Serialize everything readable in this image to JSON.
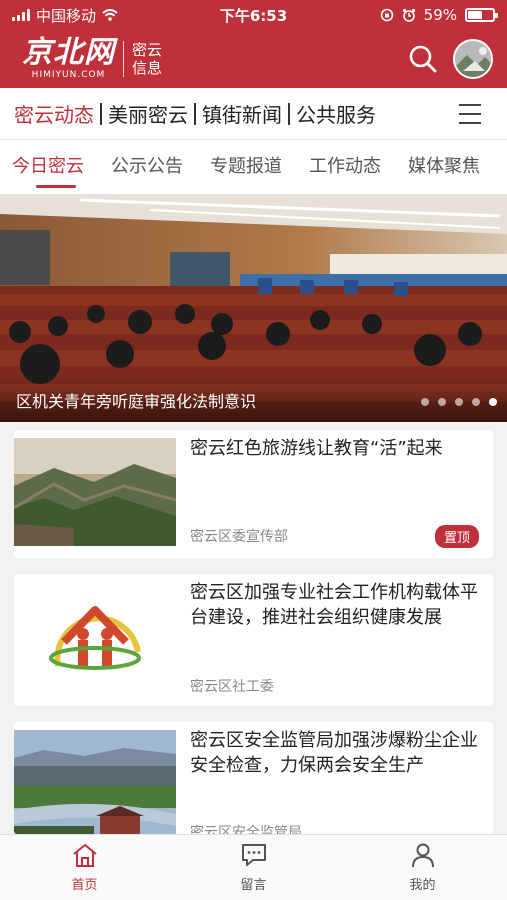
{
  "status_bar": {
    "carrier": "中国移动",
    "time": "下午6:53",
    "battery": "59%",
    "battery_level": 0.59
  },
  "app_bar": {
    "logo_title": "京北网",
    "logo_sub": "HIMIYUN.COM",
    "logo_side": [
      "密云",
      "信息"
    ],
    "brand_color": "#c0303a"
  },
  "main_nav": {
    "tabs": [
      "密云动态",
      "美丽密云",
      "镇街新闻",
      "公共服务"
    ],
    "active_index": 0
  },
  "sub_nav": {
    "tabs": [
      "今日密云",
      "公示公告",
      "专题报道",
      "工作动态",
      "媒体聚焦"
    ],
    "active_index": 0
  },
  "banner": {
    "caption": "区机关青年旁听庭审强化法制意识",
    "slide_count": 5,
    "active_slide": 4
  },
  "news": [
    {
      "title": "密云红色旅游线让教育“活”起来",
      "source": "密云区委宣传部",
      "badge": "置顶"
    },
    {
      "title": "密云区加强专业社会工作机构载体平台建设，推进社会组织健康发展",
      "source": "密云区社工委"
    },
    {
      "title": "密云区安全监管局加强涉爆粉尘企业安全检查，力保两会安全生产",
      "source": "密云区安全监管局"
    }
  ],
  "tab_bar": {
    "items": [
      {
        "label": "首页",
        "icon": "home-icon"
      },
      {
        "label": "留言",
        "icon": "message-icon"
      },
      {
        "label": "我的",
        "icon": "user-icon"
      }
    ],
    "active_index": 0
  }
}
